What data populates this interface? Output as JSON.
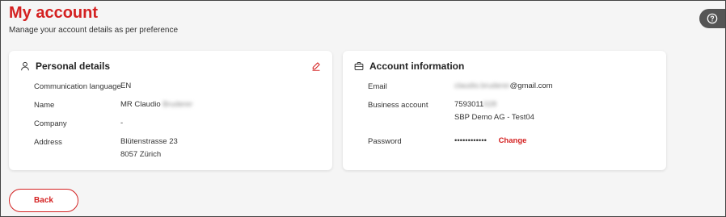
{
  "header": {
    "title": "My account",
    "subtitle": "Manage your account details as per preference"
  },
  "help": {
    "icon": "question-circle-icon"
  },
  "personal": {
    "title": "Personal details",
    "icon": "person-icon",
    "edit_icon": "pencil-edit-icon",
    "rows": [
      {
        "label": "Communication language",
        "value": "EN"
      },
      {
        "label": "Name",
        "value": "MR Claudio",
        "hidden": "Bruderer"
      },
      {
        "label": "Company",
        "value": "-"
      },
      {
        "label": "Address",
        "value_line1": "Blütenstrasse 23",
        "value_line2": "8057 Zürich"
      }
    ]
  },
  "account": {
    "title": "Account information",
    "icon": "briefcase-icon",
    "email_label": "Email",
    "email_hidden": "claudio.bruderer",
    "email_domain": "@gmail.com",
    "business_label": "Business account",
    "business_number": "7593011",
    "business_number_hidden": "028",
    "business_name": "SBP Demo AG - Test04",
    "password_label": "Password",
    "password_value": "••••••••••••",
    "change_label": "Change"
  },
  "footer": {
    "back_label": "Back"
  },
  "colors": {
    "accent": "#d42121",
    "background": "#f5f5f5"
  }
}
